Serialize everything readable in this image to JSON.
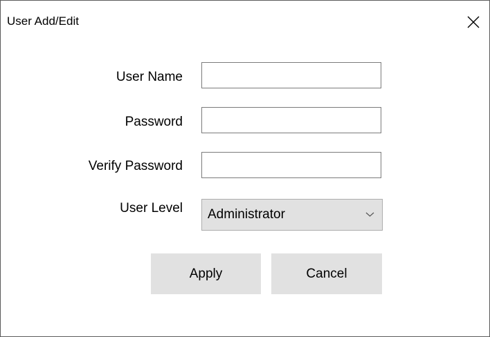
{
  "window": {
    "title": "User Add/Edit",
    "close_icon": "close-icon"
  },
  "form": {
    "user_name": {
      "label": "User Name",
      "value": ""
    },
    "password": {
      "label": "Password",
      "value": ""
    },
    "verify_password": {
      "label": "Verify Password",
      "value": ""
    },
    "user_level": {
      "label": "User Level",
      "selected": "Administrator",
      "icon": "chevron-down-icon"
    }
  },
  "buttons": {
    "apply_label": "Apply",
    "cancel_label": "Cancel"
  },
  "colors": {
    "button_bg": "#e1e1e1",
    "field_border": "#7a7a7a",
    "window_border": "#5a5a5a"
  }
}
